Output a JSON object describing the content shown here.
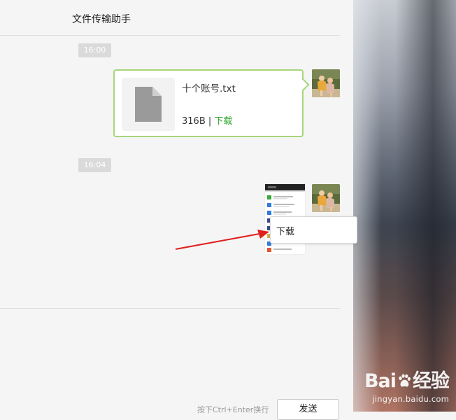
{
  "window": {
    "title": "文件传输助手"
  },
  "messages": [
    {
      "time": "16:00",
      "type": "file",
      "file_name": "十个账号.txt",
      "file_size": "316B",
      "separator": "|",
      "download_label": "下载"
    },
    {
      "time": "16:04",
      "type": "image"
    }
  ],
  "context_menu": {
    "items": [
      {
        "label": "下载"
      }
    ]
  },
  "composer": {
    "hint": "按下Ctrl+Enter换行",
    "send_label": "发送"
  },
  "watermark": {
    "brand_left": "Bai",
    "brand_right": "经验",
    "url": "jingyan.baidu.com"
  },
  "colors": {
    "accent_green": "#2aa52a",
    "bubble_border": "#a8d57c",
    "annotation_arrow": "#e0201c"
  }
}
